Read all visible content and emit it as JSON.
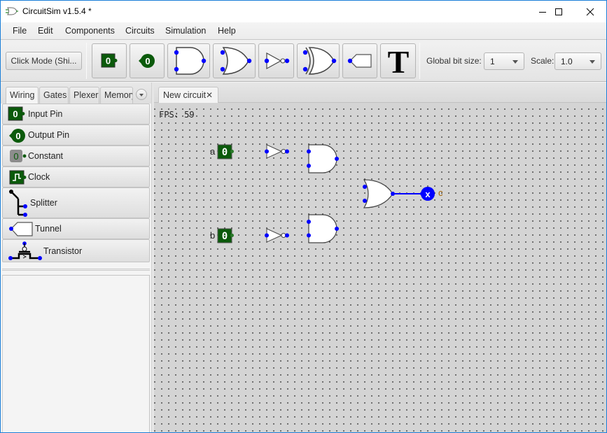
{
  "window": {
    "title": "CircuitSim v1.5.4 *",
    "controls": [
      "minimize",
      "maximize",
      "close"
    ]
  },
  "menu": [
    "File",
    "Edit",
    "Components",
    "Circuits",
    "Simulation",
    "Help"
  ],
  "toolbar": {
    "click_mode_label": "Click Mode (Shi...",
    "tools": [
      {
        "name": "input-pin",
        "glyph": "0"
      },
      {
        "name": "output-pin",
        "glyph": "0"
      },
      {
        "name": "and-gate"
      },
      {
        "name": "or-gate"
      },
      {
        "name": "not-gate"
      },
      {
        "name": "xor-gate"
      },
      {
        "name": "tunnel"
      },
      {
        "name": "text",
        "glyph": "T"
      }
    ],
    "bit_size_label": "Global bit size:",
    "bit_size_value": "1",
    "scale_label": "Scale:",
    "scale_value": "1.0"
  },
  "left_panel": {
    "tabs": [
      "Wiring",
      "Gates",
      "Plexer",
      "Memory"
    ],
    "active_tab": "Wiring",
    "components": [
      {
        "label": "Input Pin",
        "icon": "input-pin-icon",
        "glyph": "0"
      },
      {
        "label": "Output Pin",
        "icon": "output-pin-icon",
        "glyph": "0"
      },
      {
        "label": "Constant",
        "icon": "constant-icon",
        "glyph": "0"
      },
      {
        "label": "Clock",
        "icon": "clock-icon"
      },
      {
        "label": "Splitter",
        "icon": "splitter-icon"
      },
      {
        "label": "Tunnel",
        "icon": "tunnel-icon"
      },
      {
        "label": "Transistor",
        "icon": "transistor-icon"
      }
    ]
  },
  "circuit_tabs": [
    {
      "label": "New circuit",
      "close": "✕",
      "active": true
    }
  ],
  "canvas": {
    "fps_text": "FPS: 59",
    "input_a": {
      "label": "a",
      "value": "0"
    },
    "input_b": {
      "label": "b",
      "value": "0"
    },
    "output_c": {
      "label": "c",
      "value": "x"
    },
    "colors": {
      "wire": "#0000ff",
      "pin_fill": "#0b5a0b",
      "port": "#0000ff",
      "grid_bg": "#d4d4d4"
    }
  }
}
